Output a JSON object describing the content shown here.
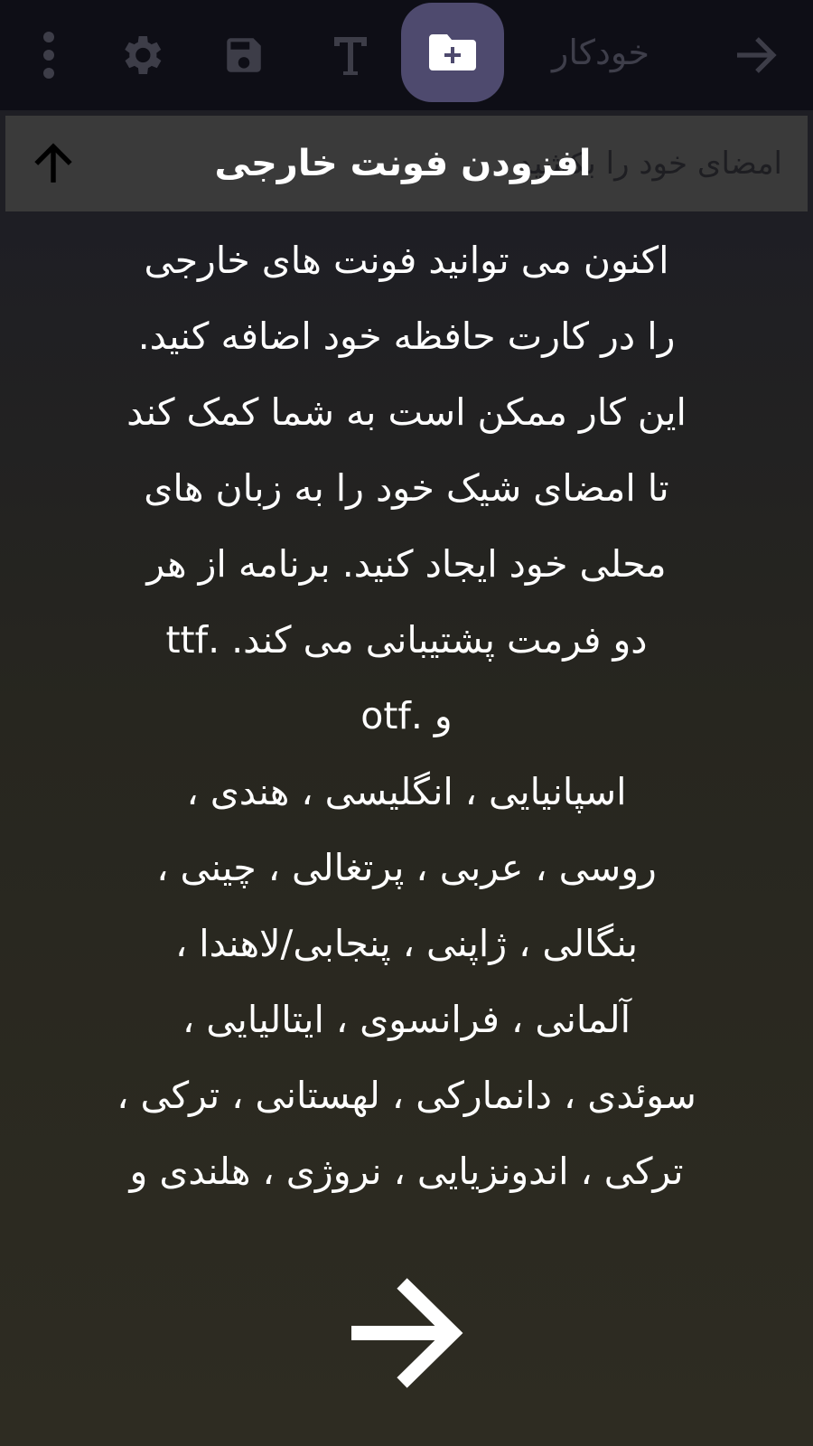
{
  "toolbar": {
    "title": "خودکار",
    "icons": {
      "back": "arrow-right-icon",
      "add_font": "folder-plus-icon",
      "text": "text-icon",
      "save": "save-icon",
      "settings": "gear-icon",
      "more": "more-vertical-icon"
    }
  },
  "subbar": {
    "hint": "امضای خود را بکشید",
    "title": "افزودن فونت خارجی",
    "icon": "arrow-up-icon"
  },
  "content": {
    "body": "اکنون می توانید فونت های خارجی\nرا در کارت حافظه خود اضافه کنید.\nاین کار ممکن است به شما کمک کند\nتا امضای شیک خود را به زبان های\nمحلی خود ایجاد کنید.  برنامه از هر\nدو فرمت پشتیبانی می کند. .ttf\nو .otf\nاسپانیایی ، انگلیسی ، هندی ،\nروسی ، عربی ، پرتغالی ، چینی ،\nبنگالی ، ژاپنی ، پنجابی/لاهندا ،\nآلمانی ، فرانسوی ، ایتالیایی ،\nسوئدی ، دانمارکی ، لهستانی ، ترکی ،\nترکی ، اندونزیایی ، نروژی ، هلندی و"
  },
  "next_icon": "arrow-right-icon",
  "colors": {
    "toolbar_bg": "#0e0e16",
    "fab_bg": "#4e4a6e",
    "subbar_bg": "#3a3a3a",
    "text": "#ffffff"
  }
}
